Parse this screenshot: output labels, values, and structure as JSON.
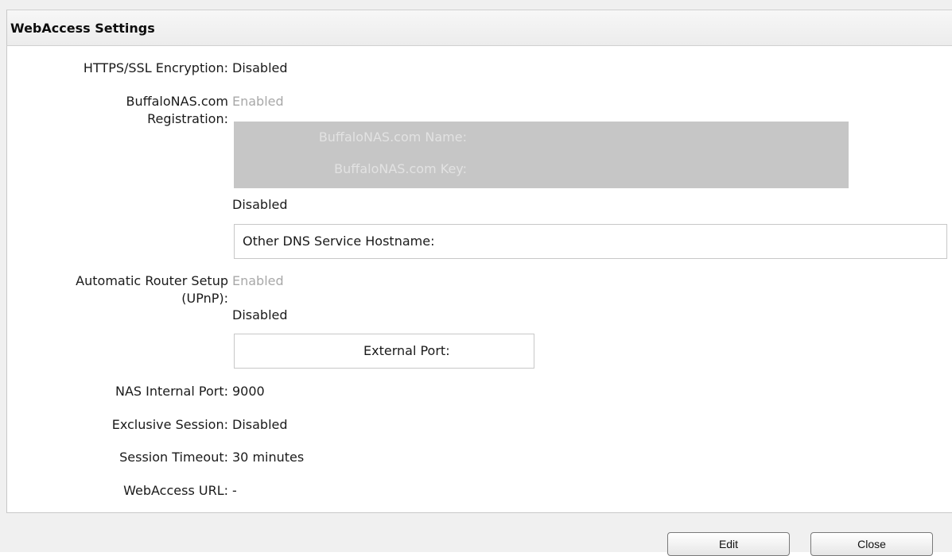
{
  "window": {
    "title": "WebAccess Settings"
  },
  "settings": {
    "https_ssl": {
      "label": "HTTPS/SSL Encryption:",
      "value": "Disabled"
    },
    "buffalonas": {
      "label_line1": "BuffaloNAS.com",
      "label_line2": "Registration:",
      "option_enabled": "Enabled",
      "name_label": "BuffaloNAS.com Name:",
      "key_label": "BuffaloNAS.com Key:",
      "option_disabled": "Disabled",
      "other_dns_label": "Other DNS Service Hostname:"
    },
    "upnp": {
      "label_line1": "Automatic Router Setup",
      "label_line2": "(UPnP):",
      "option_enabled": "Enabled",
      "option_disabled": "Disabled",
      "external_port_label": "External Port:"
    },
    "internal_port": {
      "label": "NAS Internal Port:",
      "value": "9000"
    },
    "exclusive_session": {
      "label": "Exclusive Session:",
      "value": "Disabled"
    },
    "session_timeout": {
      "label": "Session Timeout:",
      "value": "30 minutes"
    },
    "webaccess_url": {
      "label": "WebAccess URL:",
      "value": "-"
    }
  },
  "footer": {
    "edit_label": "Edit",
    "close_label": "Close"
  },
  "colors": {
    "muted_text": "#a8a8a8",
    "gray_panel": "#c6c6c6",
    "panel_text": "#e2e2e2"
  }
}
